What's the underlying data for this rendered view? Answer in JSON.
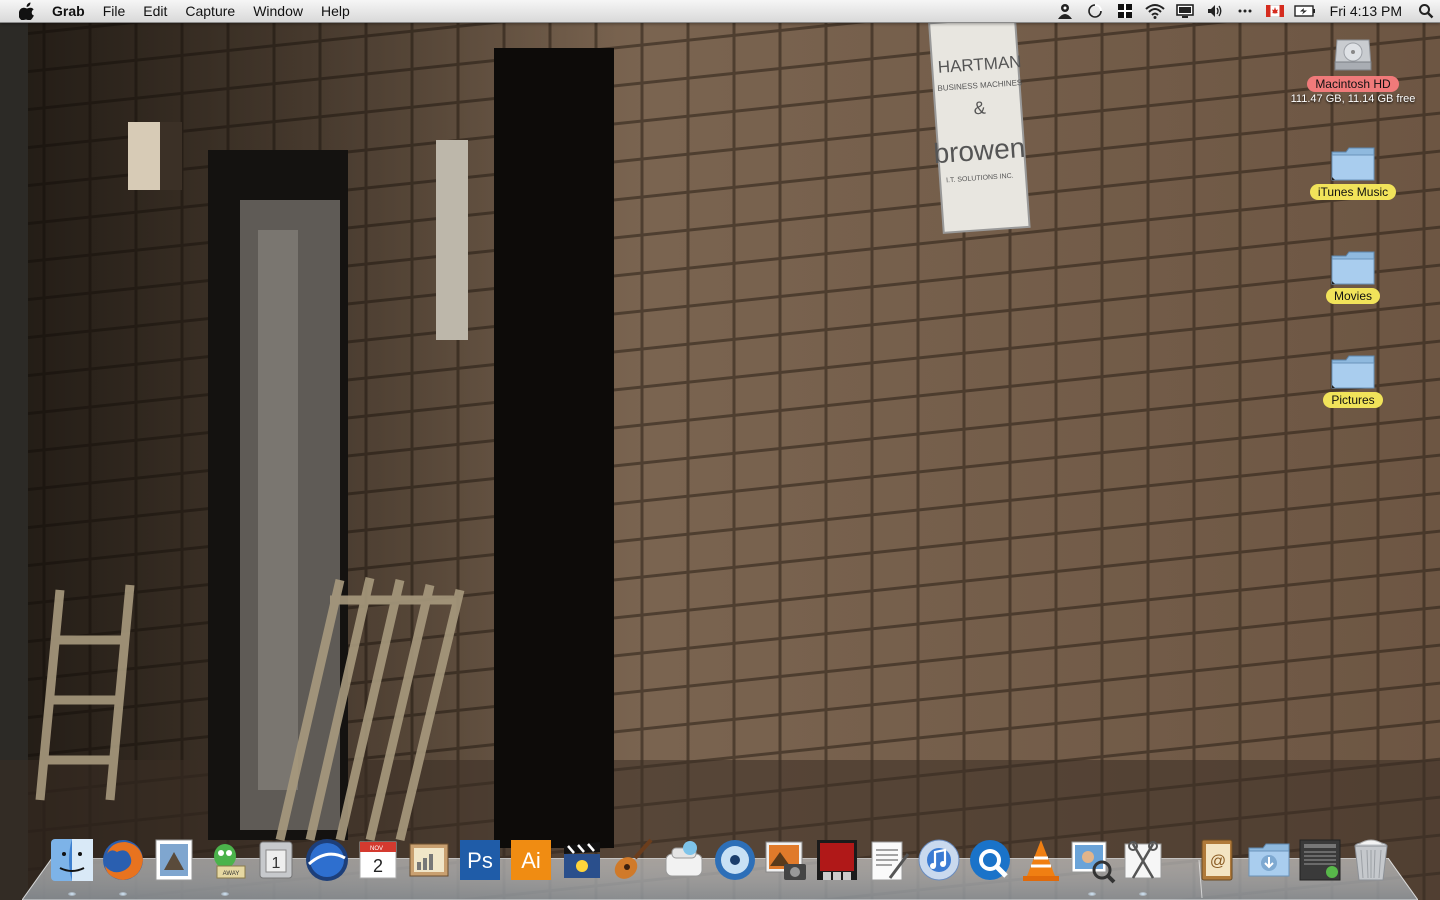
{
  "menubar": {
    "app_name": "Grab",
    "items": [
      "File",
      "Edit",
      "Capture",
      "Window",
      "Help"
    ],
    "clock": "Fri 4:13 PM",
    "status_icons": [
      "user-icon",
      "sync-icon",
      "flickr-icon",
      "wifi-icon",
      "display-icon",
      "volume-icon",
      "dots-icon",
      "canada-flag-icon",
      "battery-icon"
    ]
  },
  "wallpaper": {
    "sign_lines": [
      "HARTMAN",
      "BUSINESS MACHINES",
      "&",
      "browen",
      "I.T. SOLUTIONS INC."
    ]
  },
  "desktop": {
    "hd": {
      "label": "Macintosh HD",
      "sub": "111.47 GB, 11.14 GB free"
    },
    "folders": [
      {
        "label": "iTunes Music"
      },
      {
        "label": "Movies"
      },
      {
        "label": "Pictures"
      }
    ]
  },
  "dock": {
    "apps": [
      {
        "name": "finder",
        "running": true
      },
      {
        "name": "firefox",
        "running": true
      },
      {
        "name": "mail",
        "running": false
      },
      {
        "name": "adium",
        "running": true
      },
      {
        "name": "system-preferences",
        "running": false
      },
      {
        "name": "google-earth",
        "running": false
      },
      {
        "name": "ical",
        "running": false
      },
      {
        "name": "iphoto-viewer",
        "running": false
      },
      {
        "name": "photoshop",
        "running": false
      },
      {
        "name": "illustrator",
        "running": false
      },
      {
        "name": "imovie",
        "running": false
      },
      {
        "name": "garageband",
        "running": false
      },
      {
        "name": "transmit",
        "running": false
      },
      {
        "name": "dvd-player",
        "running": false
      },
      {
        "name": "iphoto",
        "running": false
      },
      {
        "name": "front-row",
        "running": false
      },
      {
        "name": "textedit",
        "running": false
      },
      {
        "name": "itunes",
        "running": false
      },
      {
        "name": "quicktime",
        "running": false
      },
      {
        "name": "vlc",
        "running": false
      },
      {
        "name": "preview",
        "running": true
      },
      {
        "name": "grab",
        "running": true
      }
    ],
    "stacks": [
      "address-book",
      "downloads-folder",
      "activity-monitor",
      "trash"
    ],
    "ps_label": "Ps",
    "ai_label": "Ai",
    "ical_month": "NOV",
    "ical_day": "2"
  }
}
